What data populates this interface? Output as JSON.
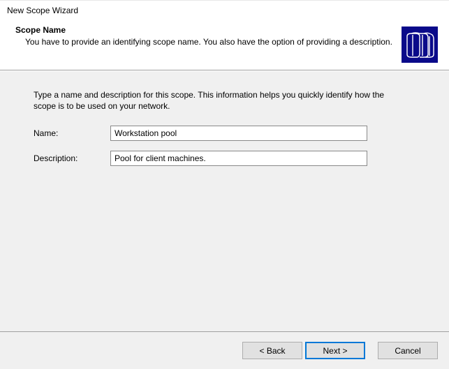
{
  "window": {
    "title": "New Scope Wizard"
  },
  "header": {
    "title": "Scope Name",
    "description": "You have to provide an identifying scope name. You also have the option of providing a description."
  },
  "content": {
    "instruction": "Type a name and description for this scope. This information helps you quickly identify how the scope is to be used on your network.",
    "name_label": "Name:",
    "name_value": "Workstation pool",
    "description_label": "Description:",
    "description_value": "Pool for client machines."
  },
  "footer": {
    "back": "< Back",
    "next": "Next >",
    "cancel": "Cancel"
  }
}
